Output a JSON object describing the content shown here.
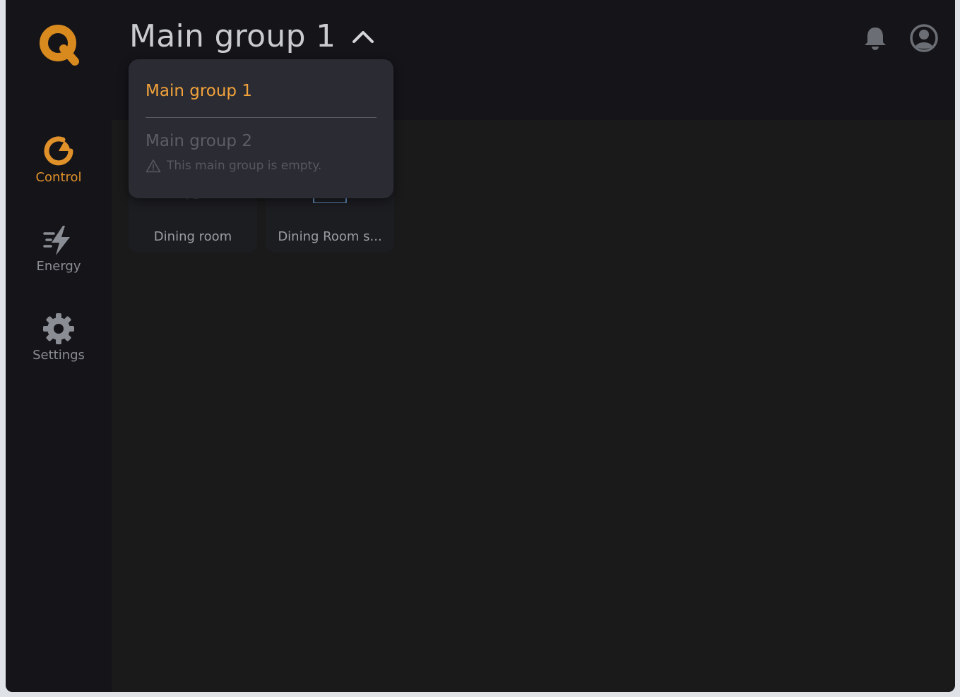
{
  "header": {
    "title": "Main group 1",
    "notifications_icon": "bell-icon",
    "account_icon": "account-icon"
  },
  "sidebar": {
    "logo_icon": "q-logo-icon",
    "items": [
      {
        "label": "Control",
        "icon": "control-icon",
        "active": true
      },
      {
        "label": "Energy",
        "icon": "energy-bolt-icon",
        "active": false
      },
      {
        "label": "Settings",
        "icon": "gear-icon",
        "active": false
      }
    ]
  },
  "dropdown": {
    "items": [
      {
        "label": "Main group 1",
        "selected": true
      },
      {
        "label": "Main group 2",
        "selected": false,
        "note": "This main group is empty."
      }
    ]
  },
  "tiles": [
    {
      "label": "Dining room",
      "icon": "fan-icon"
    },
    {
      "label": "Dining Room s...",
      "icon": "screen-icon"
    }
  ],
  "colors": {
    "accent": "#e0912a",
    "dropdown_selected": "#f2a23a",
    "background": "#141419",
    "content_bg": "#1a1a1b",
    "dropdown_bg": "#2b2c33"
  }
}
